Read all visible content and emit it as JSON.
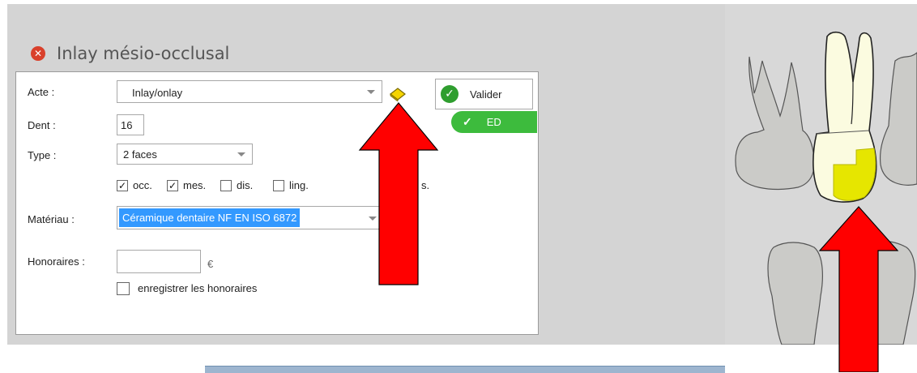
{
  "dialog": {
    "title": "Inlay mésio-occlusal",
    "close_icon": "close-circle-icon"
  },
  "form": {
    "acte_label": "Acte :",
    "acte_value": "Inlay/onlay",
    "dent_label": "Dent :",
    "dent_value": "16",
    "type_label": "Type :",
    "type_value": "2 faces",
    "faces": [
      {
        "label": "occ.",
        "checked": true
      },
      {
        "label": "mes.",
        "checked": true
      },
      {
        "label": "dis.",
        "checked": false
      },
      {
        "label": "ling.",
        "checked": false
      },
      {
        "label": "s.",
        "checked": false
      }
    ],
    "materiau_label": "Matériau :",
    "materiau_value": "Céramique dentaire NF EN ISO 6872",
    "honoraires_label": "Honoraires :",
    "honoraires_value": "",
    "currency": "€",
    "save_fees_label": "enregistrer les honoraires",
    "save_fees_checked": false
  },
  "actions": {
    "valider_label": "Valider",
    "status_badge": "ED"
  },
  "colors": {
    "annotation_arrow": "#ff0000",
    "tooth_highlight": "#e6e600",
    "status_green": "#3dbb3d"
  }
}
